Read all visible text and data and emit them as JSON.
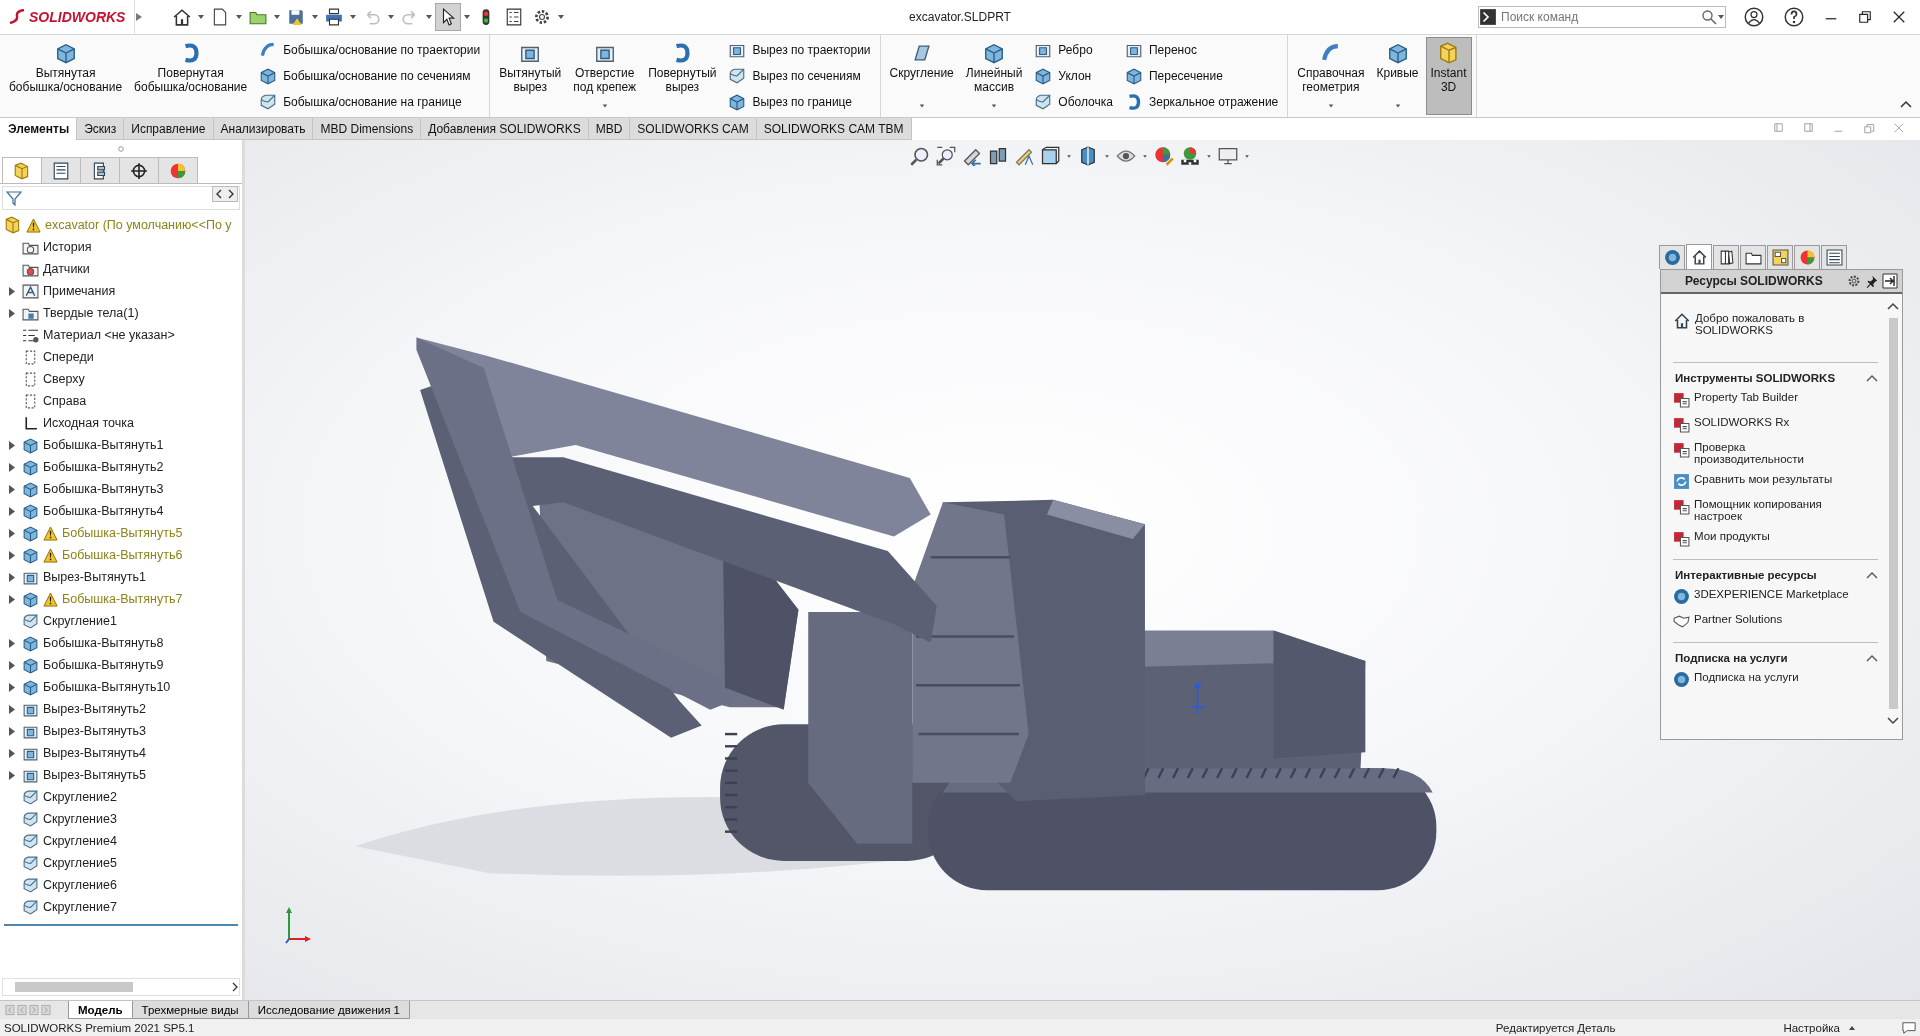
{
  "title_bar": {
    "logo": "SOLIDWORKS",
    "document_title": "excavator.SLDPRT",
    "search": {
      "placeholder": "Поиск команд"
    },
    "quick_access": [
      {
        "on": false,
        "disabled": false
      },
      {
        "on": false,
        "disabled": false
      },
      {
        "on": false,
        "disabled": false
      },
      {
        "on": false,
        "disabled": false
      },
      {
        "on": false,
        "disabled": false
      },
      {
        "on": false,
        "disabled": true
      },
      {
        "on": false,
        "disabled": true
      },
      {
        "on": true,
        "disabled": false
      },
      {
        "on": false,
        "disabled": false
      },
      {
        "on": false,
        "disabled": false
      },
      {
        "on": false,
        "disabled": false
      }
    ]
  },
  "ribbon": {
    "groups": [
      {
        "items": [
          {
            "kind": "large",
            "label": "Вытянутая\nбобышка/основание",
            "dropdown": false,
            "on": false
          },
          {
            "kind": "large",
            "label": "Повернутая\nбобышка/основание",
            "dropdown": false,
            "on": false
          },
          {
            "kind": "small",
            "label": "Бобышка/основание по траектории",
            "dropdown": false,
            "on": false
          },
          {
            "kind": "small",
            "label": "Бобышка/основание по сечениям",
            "dropdown": false,
            "on": false
          },
          {
            "kind": "small",
            "label": "Бобышка/основание на границе",
            "dropdown": false,
            "on": false
          }
        ]
      },
      {
        "items": [
          {
            "kind": "large",
            "label": "Вытянутый\nвырез",
            "dropdown": false,
            "on": false
          },
          {
            "kind": "large",
            "label": "Отверстие\nпод крепеж",
            "dropdown": true,
            "on": false
          },
          {
            "kind": "large",
            "label": "Повернутый\nвырез",
            "dropdown": false,
            "on": false
          },
          {
            "kind": "small",
            "label": "Вырез по траектории",
            "dropdown": false,
            "on": false
          },
          {
            "kind": "small",
            "label": "Вырез по сечениям",
            "dropdown": false,
            "on": false
          },
          {
            "kind": "small",
            "label": "Вырез по границе",
            "dropdown": false,
            "on": false
          }
        ]
      },
      {
        "items": [
          {
            "kind": "large",
            "label": "Скругление",
            "dropdown": true,
            "on": false
          },
          {
            "kind": "large",
            "label": "Линейный\nмассив",
            "dropdown": true,
            "on": false
          },
          {
            "kind": "small",
            "label": "Ребро",
            "dropdown": false,
            "on": false
          },
          {
            "kind": "small",
            "label": "Уклон",
            "dropdown": false,
            "on": false
          },
          {
            "kind": "small",
            "label": "Оболочка",
            "dropdown": false,
            "on": false
          },
          {
            "kind": "small",
            "label": "Перенос",
            "dropdown": false,
            "on": false
          },
          {
            "kind": "small",
            "label": "Пересечение",
            "dropdown": false,
            "on": false
          },
          {
            "kind": "small",
            "label": "Зеркальное отражение",
            "dropdown": false,
            "on": false
          }
        ]
      },
      {
        "items": [
          {
            "kind": "large",
            "label": "Справочная\nгеометрия",
            "dropdown": true,
            "on": false
          },
          {
            "kind": "large",
            "label": "Кривые",
            "dropdown": true,
            "on": false
          },
          {
            "kind": "large",
            "label": "Instant\n3D",
            "dropdown": false,
            "on": true
          }
        ]
      }
    ]
  },
  "tabs": [
    {
      "label": "Элементы",
      "selected": true
    },
    {
      "label": "Эскиз",
      "selected": false
    },
    {
      "label": "Исправление",
      "selected": false
    },
    {
      "label": "Анализировать",
      "selected": false
    },
    {
      "label": "MBD Dimensions",
      "selected": false
    },
    {
      "label": "Добавления SOLIDWORKS",
      "selected": false
    },
    {
      "label": "MBD",
      "selected": false
    },
    {
      "label": "SOLIDWORKS CAM",
      "selected": false
    },
    {
      "label": "SOLIDWORKS CAM TBM",
      "selected": false
    }
  ],
  "feature_manager": {
    "panel_tabs": [
      {
        "selected": true
      },
      {
        "selected": false
      },
      {
        "selected": false
      },
      {
        "selected": false
      },
      {
        "selected": false
      }
    ],
    "root": {
      "label": "excavator  (По умолчанию<<По у",
      "warning": true
    },
    "items": [
      {
        "label": "История",
        "kind": "history",
        "expandable": false,
        "warning": false
      },
      {
        "label": "Датчики",
        "kind": "sensors",
        "expandable": false,
        "warning": false
      },
      {
        "label": "Примечания",
        "kind": "annotations",
        "expandable": true,
        "warning": false
      },
      {
        "label": "Твердые тела(1)",
        "kind": "bodies",
        "expandable": true,
        "warning": false
      },
      {
        "label": "Материал <не указан>",
        "kind": "material",
        "expandable": false,
        "warning": false
      },
      {
        "label": "Спереди",
        "kind": "plane",
        "expandable": false,
        "warning": false
      },
      {
        "label": "Сверху",
        "kind": "plane",
        "expandable": false,
        "warning": false
      },
      {
        "label": "Справа",
        "kind": "plane",
        "expandable": false,
        "warning": false
      },
      {
        "label": "Исходная точка",
        "kind": "origin",
        "expandable": false,
        "warning": false
      },
      {
        "label": "Бобышка-Вытянуть1",
        "kind": "boss",
        "expandable": true,
        "warning": false
      },
      {
        "label": "Бобышка-Вытянуть2",
        "kind": "boss",
        "expandable": true,
        "warning": false
      },
      {
        "label": "Бобышка-Вытянуть3",
        "kind": "boss",
        "expandable": true,
        "warning": false
      },
      {
        "label": "Бобышка-Вытянуть4",
        "kind": "boss",
        "expandable": true,
        "warning": false
      },
      {
        "label": "Бобышка-Вытянуть5",
        "kind": "boss",
        "expandable": true,
        "warning": true
      },
      {
        "label": "Бобышка-Вытянуть6",
        "kind": "boss",
        "expandable": true,
        "warning": true
      },
      {
        "label": "Вырез-Вытянуть1",
        "kind": "cut",
        "expandable": true,
        "warning": false
      },
      {
        "label": "Бобышка-Вытянуть7",
        "kind": "boss",
        "expandable": true,
        "warning": true
      },
      {
        "label": "Скругление1",
        "kind": "fillet",
        "expandable": false,
        "warning": false
      },
      {
        "label": "Бобышка-Вытянуть8",
        "kind": "boss",
        "expandable": true,
        "warning": false
      },
      {
        "label": "Бобышка-Вытянуть9",
        "kind": "boss",
        "expandable": true,
        "warning": false
      },
      {
        "label": "Бобышка-Вытянуть10",
        "kind": "boss",
        "expandable": true,
        "warning": false
      },
      {
        "label": "Вырез-Вытянуть2",
        "kind": "cut",
        "expandable": true,
        "warning": false
      },
      {
        "label": "Вырез-Вытянуть3",
        "kind": "cut",
        "expandable": true,
        "warning": false
      },
      {
        "label": "Вырез-Вытянуть4",
        "kind": "cut",
        "expandable": true,
        "warning": false
      },
      {
        "label": "Вырез-Вытянуть5",
        "kind": "cut",
        "expandable": true,
        "warning": false
      },
      {
        "label": "Скругление2",
        "kind": "fillet",
        "expandable": false,
        "warning": false
      },
      {
        "label": "Скругление3",
        "kind": "fillet",
        "expandable": false,
        "warning": false
      },
      {
        "label": "Скругление4",
        "kind": "fillet",
        "expandable": false,
        "warning": false
      },
      {
        "label": "Скругление5",
        "kind": "fillet",
        "expandable": false,
        "warning": false
      },
      {
        "label": "Скругление6",
        "kind": "fillet",
        "expandable": false,
        "warning": false
      },
      {
        "label": "Скругление7",
        "kind": "fillet",
        "expandable": false,
        "warning": false
      }
    ]
  },
  "task_pane": {
    "tabs": [
      {
        "selected": false
      },
      {
        "selected": true
      },
      {
        "selected": false
      },
      {
        "selected": false
      },
      {
        "selected": false
      },
      {
        "selected": false
      },
      {
        "selected": false
      }
    ],
    "title": "Ресурсы SOLIDWORKS",
    "welcome": "Добро пожаловать в\nSOLIDWORKS",
    "sections": [
      {
        "title": "Инструменты SOLIDWORKS",
        "expanded": true,
        "items": [
          {
            "label": "Property Tab Builder",
            "kind": "tool"
          },
          {
            "label": "SOLIDWORKS Rx",
            "kind": "tool"
          },
          {
            "label": "Проверка\nпроизводительности",
            "kind": "tool"
          },
          {
            "label": "Сравнить мои результаты",
            "kind": "compare"
          },
          {
            "label": "Помощник копирования\nнастроек",
            "kind": "tool"
          },
          {
            "label": "Мои продукты",
            "kind": "tool"
          }
        ]
      },
      {
        "title": "Интерактивные ресурсы",
        "expanded": true,
        "items": [
          {
            "label": "3DEXPERIENCE Marketplace",
            "kind": "globe"
          },
          {
            "label": "Partner Solutions",
            "kind": "handshake"
          }
        ]
      },
      {
        "title": "Подписка на услуги",
        "expanded": true,
        "items": [
          {
            "label": "Подписка на услуги",
            "kind": "globe"
          }
        ]
      }
    ]
  },
  "bottom_tabs": [
    {
      "label": "Модель",
      "selected": true
    },
    {
      "label": "Трехмерные виды",
      "selected": false
    },
    {
      "label": "Исследование движения 1",
      "selected": false
    }
  ],
  "status_bar": {
    "product": "SOLIDWORKS Premium 2021 SP5.1",
    "mode": "Редактируется Деталь",
    "settings": "Настройка"
  }
}
